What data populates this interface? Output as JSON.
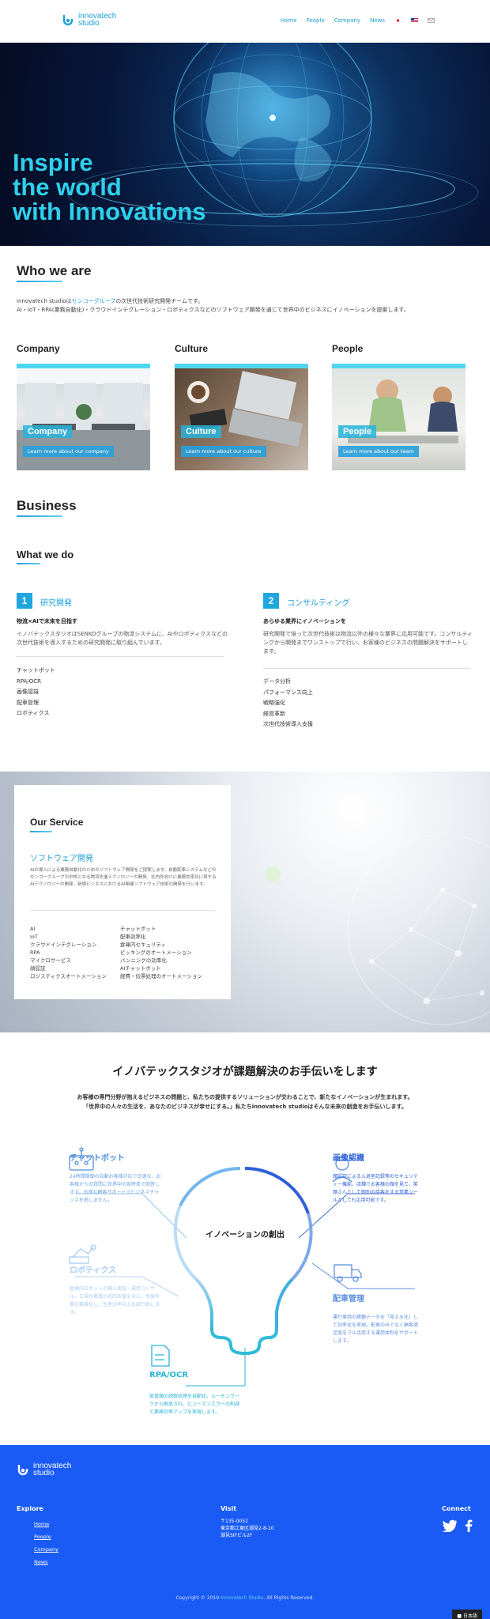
{
  "header": {
    "logo_line1": "innovatech",
    "logo_line2": "studio",
    "nav": [
      "Home",
      "People",
      "Company",
      "News"
    ]
  },
  "hero": {
    "title_line1": "Inspire",
    "title_line2": "the world",
    "title_line3": "with Innovations"
  },
  "who": {
    "heading": "Who we are",
    "text1_a": "innovatech studioは",
    "text1_link": "センコーグループ",
    "text1_b": "の次世代技術研究開発チームです。",
    "text2": "AI・IoT・RPA(業務自動化)・クラウドインテグレーション・ロボティクスなどのソフトウェア開発を通じて世界中のビジネスにイノベーションを提案します。"
  },
  "cards": [
    {
      "heading": "Company",
      "label": "Company",
      "button": "Learn more about our company"
    },
    {
      "heading": "Culture",
      "label": "Culture",
      "button": "Learn more about our culture"
    },
    {
      "heading": "People",
      "label": "People",
      "button": "Learn more about our team"
    }
  ],
  "business": {
    "heading": "Business",
    "subheading": "What we do",
    "cols": [
      {
        "num": "1",
        "title": "研究開発",
        "sub": "物流×AIで未来を目指す",
        "text": "イノバテックスタジオはSENKOグループの物流システムに、AIやロボティクスなどの次世代技術を導入するための研究開発に取り組んでいます。",
        "items": [
          "チャットボット",
          "RPA/OCR",
          "画像認識",
          "配車管理",
          "ロボティクス"
        ]
      },
      {
        "num": "2",
        "title": "コンサルティング",
        "sub": "あらゆる業界にイノベーションを",
        "text": "研究開発で培った次世代技術は物流以外の様々な業界に応用可能です。コンサルティングから開発までワンストップで行い、お客様のビジネスの問題解決をサポートします。",
        "items": [
          "データ分析",
          "パフォーマンス向上",
          "戦略強化",
          "経営革新",
          "次世代技術導入支援"
        ]
      }
    ]
  },
  "service": {
    "heading": "Our Service",
    "title": "ソフトウェア開発",
    "text": "AIの導入による業務自動化のためのソフトウェア開発をご提案します。自動配車システムなどのセンコーグループの中核となる物流先進テクノロジーの開発、社内外向けに業務効率化に資するAIテクノロジーの開発。新規ビジネスにおけるAI関連ソフトウェア技術の開発を行います。",
    "list_left": [
      "AI",
      "IoT",
      "クラウドインテグレーション",
      "RPA",
      "マイクロサービス",
      "顔認証",
      "ロジスティクスオートメーション"
    ],
    "list_right": [
      "チャットボット",
      "配車効率化",
      "倉庫内セキュリティ",
      "ピッキングのオートメーション",
      "バンニングの効率化",
      "AIチャットボット",
      "経費・伝票処理のオートメーション"
    ]
  },
  "solution": {
    "title": "イノバテックスタジオが課題解決のお手伝いをします",
    "text1": "お客様の専門分野が抱えるビジネスの問題と、私たちの提供するソリューションが交わることで、新たなイノベーションが生まれます。",
    "text2": "「世界中の人々の生活を、あなたのビジネスが幸せにする。」私たちinnovatech studioはそんな未来の創造をお手伝いします。",
    "center": "イノベーションの創出",
    "features": [
      {
        "title": "チャットボット",
        "text": "24時間稼働の自動お客様対応で迅速な、お客様からの質問に世界中の各時差で回答します。迅速な顧客サポートでビジネスチャンスを逃しません。"
      },
      {
        "title": "画像認識",
        "text": "顔認証による入退室記録等のセキュリティー機能、店舗でお客様の顔を見て、笑顔さんとして個別の接客をする営業ツールとしても応用可能です。"
      },
      {
        "title": "ロボティクス",
        "text": "倉庫内ロボットの導入実証・運用コンサル。工場作業員の巡回支援を含む、危険作業を機械化し、生産効率向上を試行致します。"
      },
      {
        "title": "配車管理",
        "text": "運行車両の稼働データを「見える化」して効率化を実現。配車のみでなく顧客満足度をフル活用する運用体制をサポートします。"
      },
      {
        "title": "RPA/OCR",
        "text": "紙書類の読取処理を自動化。ルーチンワークから解放され、ヒューマンエラーの削減と業務効率アップを実現します。"
      }
    ]
  },
  "footer": {
    "logo_line1": "innovatech",
    "logo_line2": "studio",
    "explore_label": "Explore",
    "links": [
      "Home",
      "People",
      "Company",
      "News"
    ],
    "visit_label": "Visit",
    "address": [
      "〒135-0052",
      "東京都江東区潮見2-8-10",
      "潮見SIFビル2F"
    ],
    "connect_label": "Connect",
    "copyright_a": "Copyright © 2019 ",
    "copyright_link": "Innovatech Studio",
    "copyright_b": ". All Rights Reserved.",
    "lang": "日本語"
  },
  "colors": {
    "accent": "#1c9fd8",
    "hero_text": "#2fd0ea",
    "footer_bg": "#1a5bf5"
  }
}
